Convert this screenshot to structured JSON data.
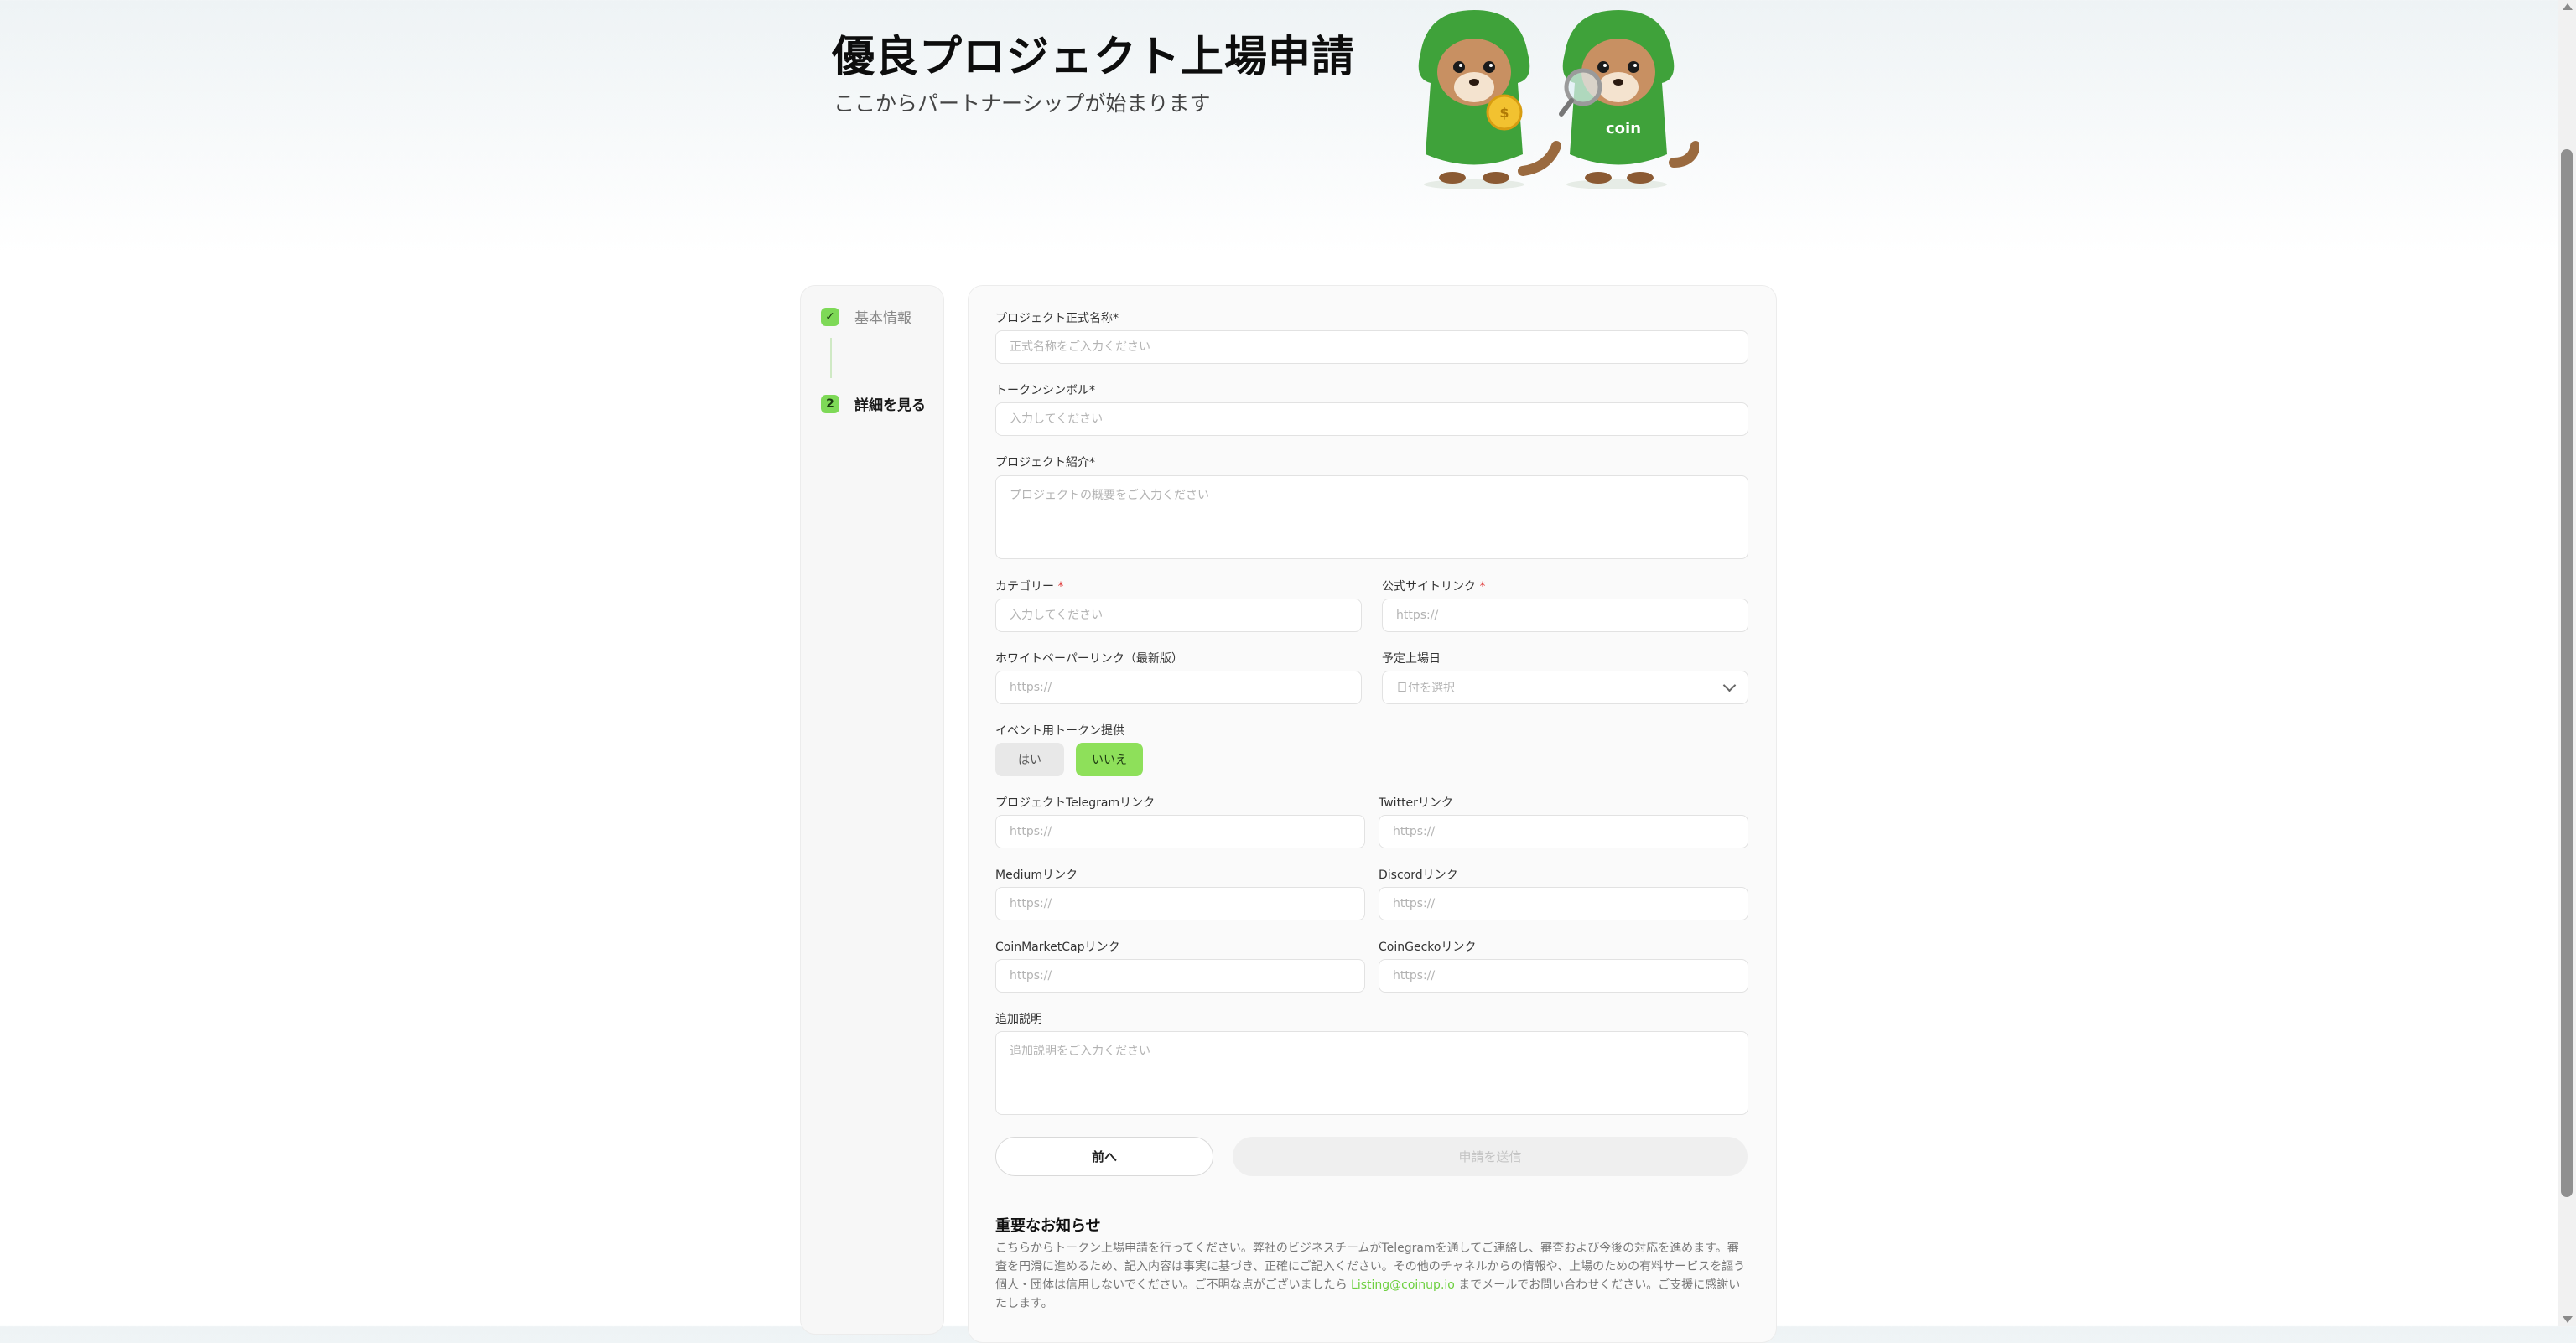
{
  "hero": {
    "title": "優良プロジェクト上場申請",
    "subtitle": "ここからパートナーシップが始まります",
    "mascot_text": "coin"
  },
  "steps": [
    {
      "badge": "✓",
      "label": "基本情報",
      "state": "done"
    },
    {
      "badge": "2",
      "label": "詳細を見る",
      "state": "active"
    }
  ],
  "form": {
    "project_name": {
      "label": "プロジェクト正式名称",
      "required": "*",
      "placeholder": "正式名称をご入力ください"
    },
    "token_symbol": {
      "label": "トークンシンボル",
      "required": "*",
      "placeholder": "入力してください"
    },
    "project_intro": {
      "label": "プロジェクト紹介",
      "required": "*",
      "placeholder": "プロジェクトの概要をご入力ください"
    },
    "category": {
      "label": "カテゴリー",
      "required": " *",
      "placeholder": "入力してください"
    },
    "website": {
      "label": "公式サイトリンク",
      "required": " *",
      "placeholder": "https://"
    },
    "whitepaper": {
      "label": "ホワイトペーパーリンク（最新版）",
      "placeholder": "https://"
    },
    "listing_date": {
      "label": "予定上場日",
      "placeholder": "日付を選択"
    },
    "event_tokens": {
      "label": "イベント用トークン提供",
      "yes": "はい",
      "no": "いいえ",
      "selected": "いいえ"
    },
    "telegram": {
      "label": "プロジェクトTelegramリンク",
      "placeholder": "https://"
    },
    "twitter": {
      "label": "Twitterリンク",
      "placeholder": "https://"
    },
    "medium": {
      "label": "Mediumリンク",
      "placeholder": "https://"
    },
    "discord": {
      "label": "Discordリンク",
      "placeholder": "https://"
    },
    "coinmarketcap": {
      "label": "CoinMarketCapリンク",
      "placeholder": "https://"
    },
    "coingecko": {
      "label": "CoinGeckoリンク",
      "placeholder": "https://"
    },
    "additional": {
      "label": "追加説明",
      "placeholder": "追加説明をご入力ください"
    }
  },
  "buttons": {
    "prev": "前へ",
    "submit": "申請を送信"
  },
  "notice": {
    "title": "重要なお知らせ",
    "body_before": "こちらからトークン上場申請を行ってください。弊社のビジネスチームがTelegramを通してご連絡し、審査および今後の対応を進めます。審査を円滑に進めるため、記入内容は事実に基づき、正確にご記入ください。その他のチャネルからの情報や、上場のための有料サービスを謳う個人・団体は信用しないでください。ご不明な点がございましたら ",
    "email": "Listing@coinup.io",
    "body_after": " までメールでお問い合わせください。ご支援に感謝いたします。"
  },
  "colors": {
    "accent": "#8ee05a",
    "link": "#6ccf3e",
    "required": "#e03b3b"
  }
}
